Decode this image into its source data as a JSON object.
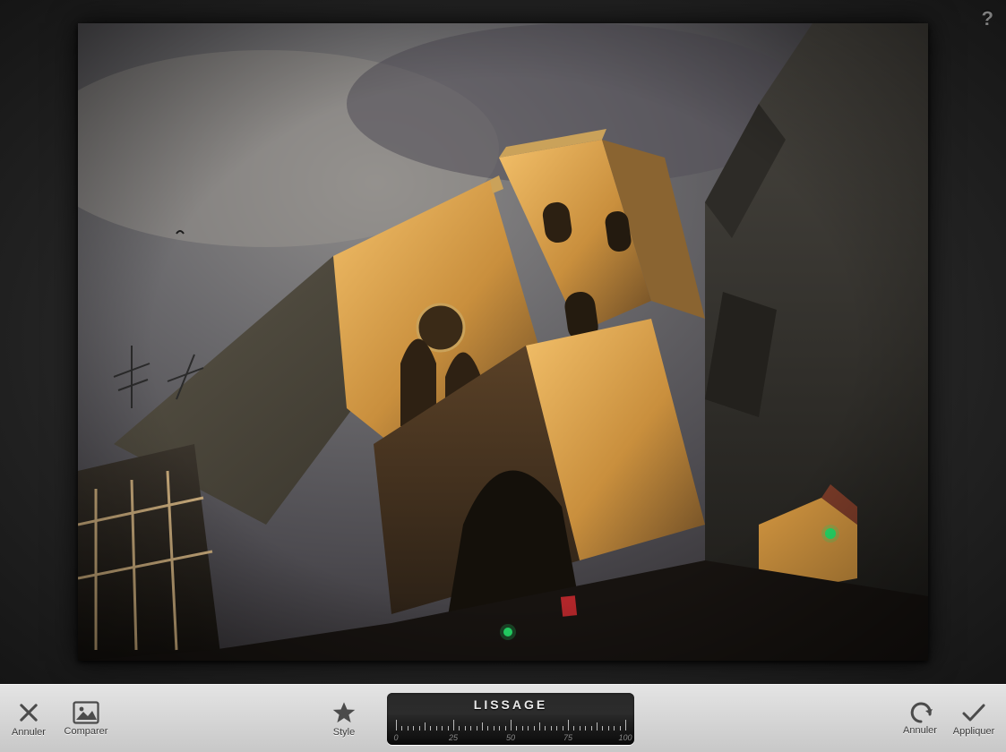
{
  "help_glyph": "?",
  "toolbar": {
    "cancel_label": "Annuler",
    "compare_label": "Comparer",
    "style_label": "Style",
    "undo_label": "Annuler",
    "apply_label": "Appliquer"
  },
  "slider": {
    "title": "LISSAGE",
    "ticks": [
      "0",
      "25",
      "50",
      "75",
      "100"
    ]
  }
}
